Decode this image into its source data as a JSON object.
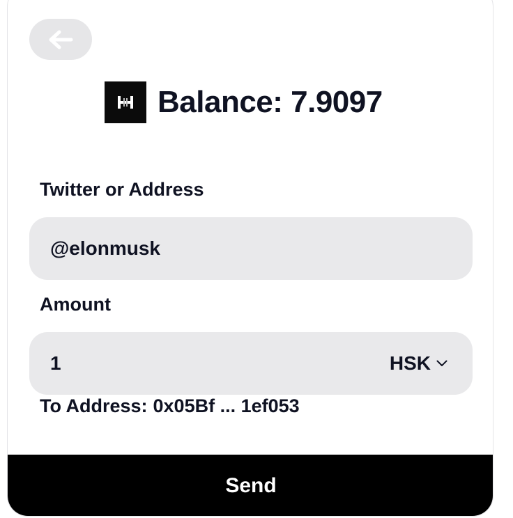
{
  "header": {
    "back_icon": "arrow-left-icon"
  },
  "balance": {
    "token_icon": "hsk-token-logo",
    "text": "Balance: 7.9097"
  },
  "recipient": {
    "label": "Twitter or Address",
    "value": "@elonmusk"
  },
  "amount": {
    "label": "Amount",
    "value": "1",
    "token": "HSK",
    "token_dropdown_icon": "chevron-down-icon"
  },
  "to_address": {
    "label": "To Address:",
    "value": "0x05Bf ... 1ef053"
  },
  "send": {
    "label": "Send"
  },
  "colors": {
    "input_bg": "#e9e9eb",
    "back_button_bg": "#e6e6e8",
    "send_bg": "#000000",
    "text": "#0f1222"
  }
}
